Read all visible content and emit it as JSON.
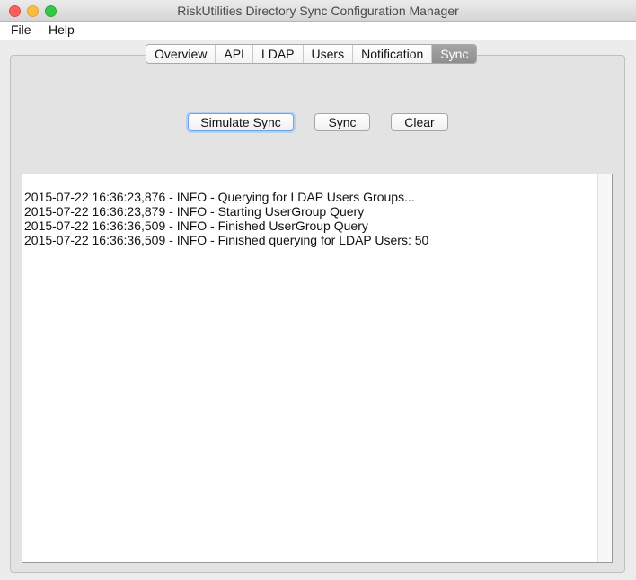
{
  "window": {
    "title": "RiskUtilities Directory Sync Configuration Manager"
  },
  "menu": {
    "items": [
      "File",
      "Help"
    ]
  },
  "tabs": {
    "items": [
      "Overview",
      "API",
      "LDAP",
      "Users",
      "Notification",
      "Sync"
    ],
    "active": "Sync"
  },
  "actions": {
    "simulate_sync": "Simulate Sync",
    "sync": "Sync",
    "clear": "Clear"
  },
  "log": {
    "lines": [
      "2015-07-22 16:36:23,876 - INFO - Querying for LDAP Users Groups...",
      "2015-07-22 16:36:23,879 - INFO - Starting UserGroup Query",
      "2015-07-22 16:36:36,509 - INFO - Finished UserGroup Query",
      "2015-07-22 16:36:36,509 - INFO - Finished querying for LDAP Users: 50"
    ]
  }
}
